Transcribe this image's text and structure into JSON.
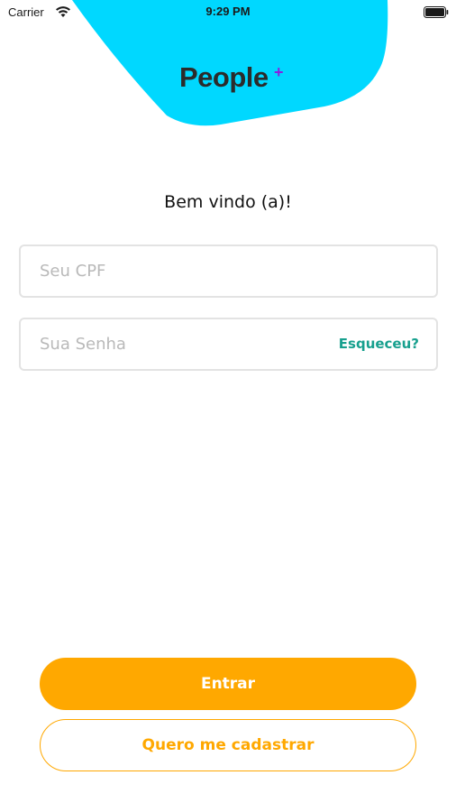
{
  "status_bar": {
    "carrier": "Carrier",
    "time": "9:29 PM",
    "wifi_icon": "wifi-icon",
    "battery_icon": "battery-icon"
  },
  "header": {
    "logo_text": "People",
    "logo_plus": "+",
    "blob_color": "#00D8FF"
  },
  "welcome": "Bem vindo (a)!",
  "form": {
    "cpf": {
      "placeholder": "Seu CPF",
      "value": ""
    },
    "password": {
      "placeholder": "Sua Senha",
      "value": ""
    },
    "forgot_label": "Esqueceu?"
  },
  "buttons": {
    "login": "Entrar",
    "register": "Quero me cadastrar"
  },
  "colors": {
    "accent": "#FFA800",
    "link": "#17A08E",
    "logo_plus": "#8A1FE0"
  }
}
